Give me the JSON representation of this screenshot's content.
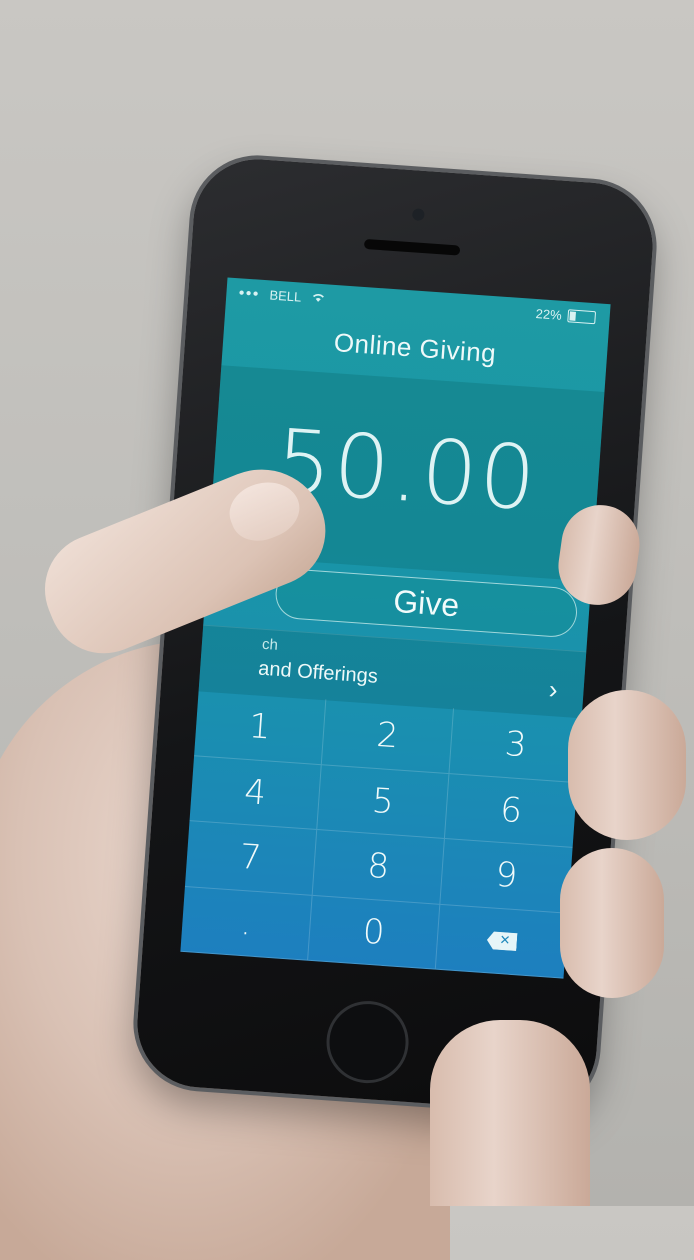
{
  "status_bar": {
    "signal": "●●●",
    "carrier": "BELL",
    "battery": "22%"
  },
  "app": {
    "title": "Online Giving",
    "amount": "50.00",
    "give_label": "Give",
    "fund_caption": "ch",
    "fund_name": "and Offerings",
    "chevron": "›"
  },
  "keypad": {
    "keys": [
      "1",
      "2",
      "3",
      "4",
      "5",
      "6",
      "7",
      "8",
      "9",
      ".",
      "0"
    ],
    "backspace_symbol": "✕"
  },
  "icons": {
    "wifi": "wifi-icon",
    "battery": "battery-icon",
    "backspace": "backspace-icon",
    "chevron": "chevron-right-icon"
  },
  "colors": {
    "screen_top": "#1e9aa4",
    "screen_bottom": "#1d7fbf",
    "background": "#c9c7c3"
  }
}
